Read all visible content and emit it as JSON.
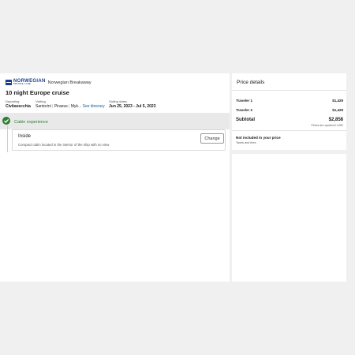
{
  "brand": {
    "logo_word": "NORWEGIAN",
    "logo_sub": "CRUISE LINE",
    "ship": "Norwegian Breakaway"
  },
  "cruise": {
    "title": "10 night Europe cruise",
    "departing_label": "Departing",
    "departing_value": "Civitavecchia",
    "visiting_label": "Visiting",
    "visiting_ports": [
      "Santorini",
      "Piraeus",
      "Myk..."
    ],
    "itinerary_link": "See itinerary",
    "sailing_label": "Sailing dates",
    "sailing_value": "Jun 25, 2023 - Jul 5, 2023"
  },
  "cabin": {
    "section_label": "Cabin experience",
    "name": "Inside",
    "description": "Compact cabin located in the interior of the ship with no view",
    "change_label": "Change"
  },
  "price": {
    "title": "Price details",
    "travelers": [
      {
        "label": "Traveler 1",
        "amount": "$1,429"
      },
      {
        "label": "Traveler 2",
        "amount": "$1,429"
      }
    ],
    "subtotal_label": "Subtotal",
    "subtotal_amount": "$2,858",
    "currency_note": "Prices are quoted in USD",
    "not_included_title": "Not included in your price",
    "not_included_item": "Taxes and fees"
  },
  "colors": {
    "brand_blue": "#1b3f8f",
    "link_blue": "#0b5fa5",
    "success_green": "#2e7d32"
  }
}
